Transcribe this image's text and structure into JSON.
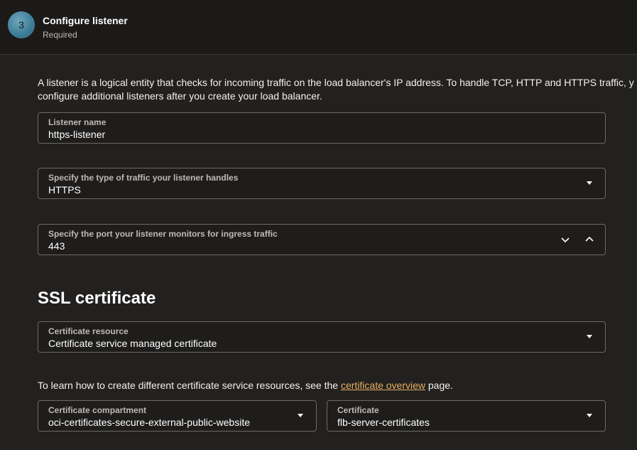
{
  "step": {
    "number": "3",
    "title": "Configure listener",
    "status": "Required"
  },
  "intro": {
    "line1": "A listener is a logical entity that checks for incoming traffic on the load balancer's IP address. To handle TCP, HTTP and HTTPS traffic, y",
    "line2": "configure additional listeners after you create your load balancer."
  },
  "listener_name": {
    "label": "Listener name",
    "value": "https-listener"
  },
  "traffic_type": {
    "label": "Specify the type of traffic your listener handles",
    "value": "HTTPS"
  },
  "port": {
    "label": "Specify the port your listener monitors for ingress traffic",
    "value": "443"
  },
  "ssl_section": {
    "title": "SSL certificate"
  },
  "certificate_resource": {
    "label": "Certificate resource",
    "value": "Certificate service managed certificate"
  },
  "help": {
    "prefix": "To learn how to create different certificate service resources, see the ",
    "link_text": "certificate overview",
    "suffix": " page."
  },
  "certificate_compartment": {
    "label": "Certificate compartment",
    "value": "oci-certificates-secure-external-public-website"
  },
  "certificate": {
    "label": "Certificate",
    "value": "flb-server-certificates"
  },
  "icons": {
    "dropdown": "chevron-down-icon",
    "decrement": "chevron-down-icon",
    "increment": "chevron-up-icon"
  }
}
